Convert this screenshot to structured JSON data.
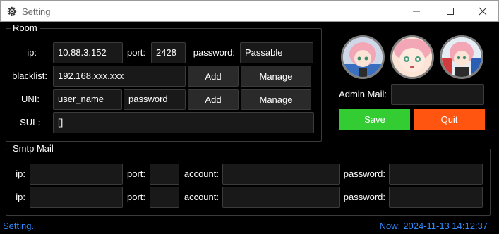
{
  "window": {
    "title": "Setting",
    "app_icon": "gear-icon",
    "controls": [
      "minimize-icon",
      "maximize-icon",
      "close-icon"
    ]
  },
  "room": {
    "label": "Room",
    "ip_label": "ip:",
    "ip_value": "10.88.3.152",
    "port_label": "port:",
    "port_value": "2428",
    "password_label": "password:",
    "password_value": "Passable",
    "blacklist_label": "blacklist:",
    "blacklist_value": "192.168.xxx.xxx",
    "blacklist_add": "Add",
    "blacklist_manage": "Manage",
    "uni_label": "UNI:",
    "uni_user_value": "user_name",
    "uni_password_value": "password",
    "uni_add": "Add",
    "uni_manage": "Manage",
    "sul_label": "SUL:",
    "sul_value": "[]"
  },
  "admin": {
    "mail_label": "Admin Mail:",
    "mail_value": "",
    "save": "Save",
    "quit": "Quit",
    "avatars": [
      "avatar-anime-girl-1",
      "avatar-anime-girl-2",
      "avatar-anime-girl-3"
    ]
  },
  "smtp": {
    "label": "Smtp Mail",
    "rows": [
      {
        "ip_label": "ip:",
        "ip_value": "",
        "port_label": "port:",
        "port_value": "",
        "account_label": "account:",
        "account_value": "",
        "password_label": "password:",
        "password_value": ""
      },
      {
        "ip_label": "ip:",
        "ip_value": "",
        "port_label": "port:",
        "port_value": "",
        "account_label": "account:",
        "account_value": "",
        "password_label": "password:",
        "password_value": ""
      }
    ]
  },
  "status": {
    "left": "Setting.",
    "right_prefix": "Now:",
    "datetime": "2024-11-13 14:12:37"
  },
  "colors": {
    "save": "#33cc33",
    "quit": "#ff5511",
    "status_text": "#2f8bff",
    "background": "#000000"
  }
}
